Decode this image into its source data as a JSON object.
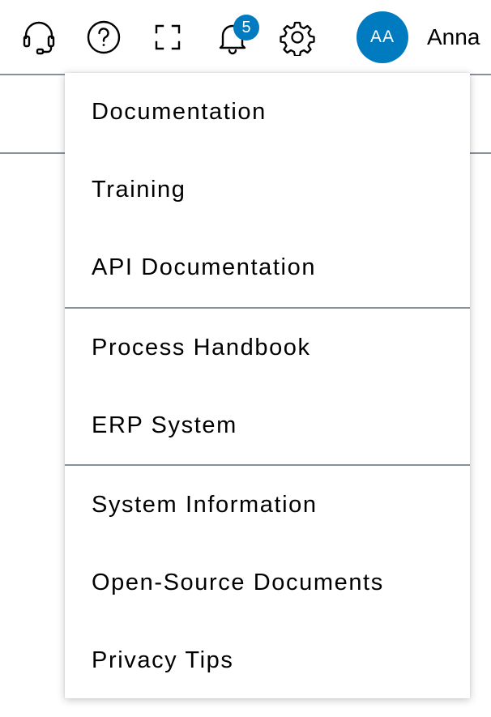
{
  "header": {
    "icons": [
      {
        "name": "headset-icon"
      },
      {
        "name": "help-icon"
      },
      {
        "name": "fullscreen-icon"
      },
      {
        "name": "bell-icon"
      },
      {
        "name": "gear-icon"
      }
    ],
    "notification_count": "5",
    "avatar_initials": "AA",
    "user_name": "Anna",
    "accent_color": "#007bc0"
  },
  "menu": {
    "items": [
      {
        "label": "Documentation"
      },
      {
        "label": "Training"
      },
      {
        "label": "API Documentation"
      },
      {
        "label": "Process Handbook"
      },
      {
        "label": "ERP System"
      },
      {
        "label": "System Information"
      },
      {
        "label": "Open-Source Documents"
      },
      {
        "label": "Privacy Tips"
      }
    ]
  }
}
